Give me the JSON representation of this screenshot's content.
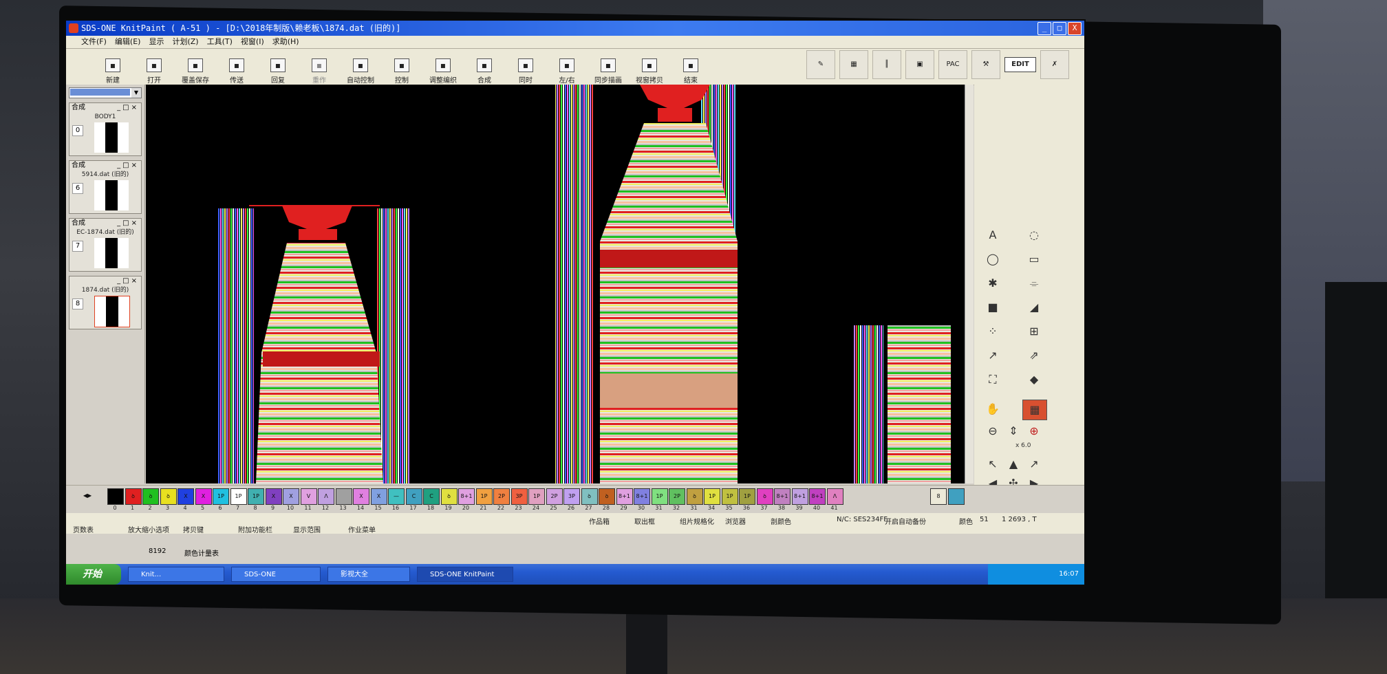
{
  "window": {
    "title": "SDS-ONE KnitPaint ( A-51 ) - [D:\\2018年制版\\赖老板\\1874.dat (旧的)]",
    "controls": {
      "minimize": "_",
      "maximize": "□",
      "close": "X"
    }
  },
  "menu": [
    "文件(F)",
    "编辑(E)",
    "显示",
    "计划(Z)",
    "工具(T)",
    "视窗(I)",
    "求助(H)"
  ],
  "toolbar": [
    {
      "label": "新建",
      "icon": "new-file-icon"
    },
    {
      "label": "打开",
      "icon": "open-folder-icon"
    },
    {
      "label": "覆盖保存",
      "icon": "save-icon"
    },
    {
      "label": "传送",
      "icon": "transfer-icon"
    },
    {
      "label": "回复",
      "icon": "undo-icon"
    },
    {
      "label": "重作",
      "icon": "redo-icon",
      "disabled": true
    },
    {
      "label": "自动控制",
      "icon": "auto-control-icon"
    },
    {
      "label": "控制",
      "icon": "control-icon"
    },
    {
      "label": "调整编织",
      "icon": "adjust-knit-icon"
    },
    {
      "label": "合成",
      "icon": "compose-icon"
    },
    {
      "label": "同时",
      "icon": "simultaneous-icon"
    },
    {
      "label": "左/右",
      "icon": "left-right-icon"
    },
    {
      "label": "同步描画",
      "icon": "sync-draw-icon"
    },
    {
      "label": "视窗拷贝",
      "icon": "window-copy-icon"
    },
    {
      "label": "结束",
      "icon": "exit-icon"
    }
  ],
  "big_tools": {
    "pac": "PAC",
    "edit": "EDIT"
  },
  "panels": [
    {
      "title": "合成",
      "file": "BODY1",
      "num": "0"
    },
    {
      "title": "合成",
      "file": "5914.dat (旧的)",
      "num": "6"
    },
    {
      "title": "合成",
      "file": "EC-1874.dat (旧的)",
      "num": "7"
    },
    {
      "title": "",
      "file": "1874.dat (旧的)",
      "num": "8",
      "active": true
    }
  ],
  "zoom_label": "x 6.0",
  "palette": {
    "colors": [
      {
        "n": "0",
        "c": "#000000",
        "t": ""
      },
      {
        "n": "1",
        "c": "#e02020",
        "t": "ꝺ"
      },
      {
        "n": "2",
        "c": "#20c020",
        "t": "ꝺ"
      },
      {
        "n": "3",
        "c": "#e8e020",
        "t": "ꝺ"
      },
      {
        "n": "4",
        "c": "#2040e0",
        "t": "X"
      },
      {
        "n": "5",
        "c": "#e020e0",
        "t": "X"
      },
      {
        "n": "6",
        "c": "#20c0e0",
        "t": "1P"
      },
      {
        "n": "7",
        "c": "#ffffff",
        "t": "1P"
      },
      {
        "n": "8",
        "c": "#40b0b0",
        "t": "1P"
      },
      {
        "n": "9",
        "c": "#8040c0",
        "t": "X"
      },
      {
        "n": "10",
        "c": "#a0a0e0",
        "t": "X"
      },
      {
        "n": "11",
        "c": "#e0a0e0",
        "t": "V"
      },
      {
        "n": "12",
        "c": "#c0a0e0",
        "t": "Λ"
      },
      {
        "n": "13",
        "c": "#a0a0a0",
        "t": ""
      },
      {
        "n": "14",
        "c": "#e080e0",
        "t": "X"
      },
      {
        "n": "15",
        "c": "#80a0e0",
        "t": "X"
      },
      {
        "n": "16",
        "c": "#40c0c0",
        "t": "—"
      },
      {
        "n": "17",
        "c": "#40a0c0",
        "t": "C"
      },
      {
        "n": "18",
        "c": "#20a080",
        "t": "C"
      },
      {
        "n": "19",
        "c": "#e0e040",
        "t": "ꝺ"
      },
      {
        "n": "20",
        "c": "#e0a0e0",
        "t": "8+1"
      },
      {
        "n": "21",
        "c": "#f0a040",
        "t": "1P"
      },
      {
        "n": "22",
        "c": "#f08040",
        "t": "2P"
      },
      {
        "n": "23",
        "c": "#f06040",
        "t": "3P"
      },
      {
        "n": "24",
        "c": "#e0a0c0",
        "t": "1P"
      },
      {
        "n": "25",
        "c": "#d0a0e0",
        "t": "2P"
      },
      {
        "n": "26",
        "c": "#c0a0f0",
        "t": "3P"
      },
      {
        "n": "27",
        "c": "#80c0c0",
        "t": "ꝺ"
      },
      {
        "n": "28",
        "c": "#c06020",
        "t": "ꝺ"
      },
      {
        "n": "29",
        "c": "#e0a0e0",
        "t": "8+1"
      },
      {
        "n": "30",
        "c": "#8080e0",
        "t": "8+1"
      },
      {
        "n": "31",
        "c": "#80e080",
        "t": "1P"
      },
      {
        "n": "32",
        "c": "#60c060",
        "t": "2P"
      },
      {
        "n": "31",
        "c": "#c0a040",
        "t": "ꝺ"
      },
      {
        "n": "34",
        "c": "#e0e040",
        "t": "1P"
      },
      {
        "n": "35",
        "c": "#c0c040",
        "t": "1P"
      },
      {
        "n": "36",
        "c": "#a0a040",
        "t": "1P"
      },
      {
        "n": "37",
        "c": "#e040c0",
        "t": "ꝺ"
      },
      {
        "n": "38",
        "c": "#c080c0",
        "t": "8+1"
      },
      {
        "n": "39",
        "c": "#c0a0e0",
        "t": "8+1"
      },
      {
        "n": "40",
        "c": "#c040c0",
        "t": "8+1"
      },
      {
        "n": "41",
        "c": "#e080c0",
        "t": "Λ"
      }
    ],
    "current_num": "8"
  },
  "status": {
    "items": [
      "页数表",
      "放大缩小选项",
      "拷贝键",
      "附加功能栏",
      "显示范围",
      "作业菜单"
    ],
    "right": [
      "作品箱",
      "取出框",
      "组片规格化",
      "浏览器",
      "剖颜色"
    ],
    "mode": "N/C: SES234FF",
    "auto": "开启自动备份",
    "color_label": "颜色",
    "color_val": "51",
    "coord": "1  2693 , T",
    "counter": "8192",
    "color_table": "颜色计量表"
  },
  "taskbar": {
    "start": "开始",
    "tasks": [
      "SDS-ONE",
      "影视大全",
      "SDS-ONE KnitPaint"
    ],
    "left_task": "Knit...",
    "clock": "16:07"
  }
}
